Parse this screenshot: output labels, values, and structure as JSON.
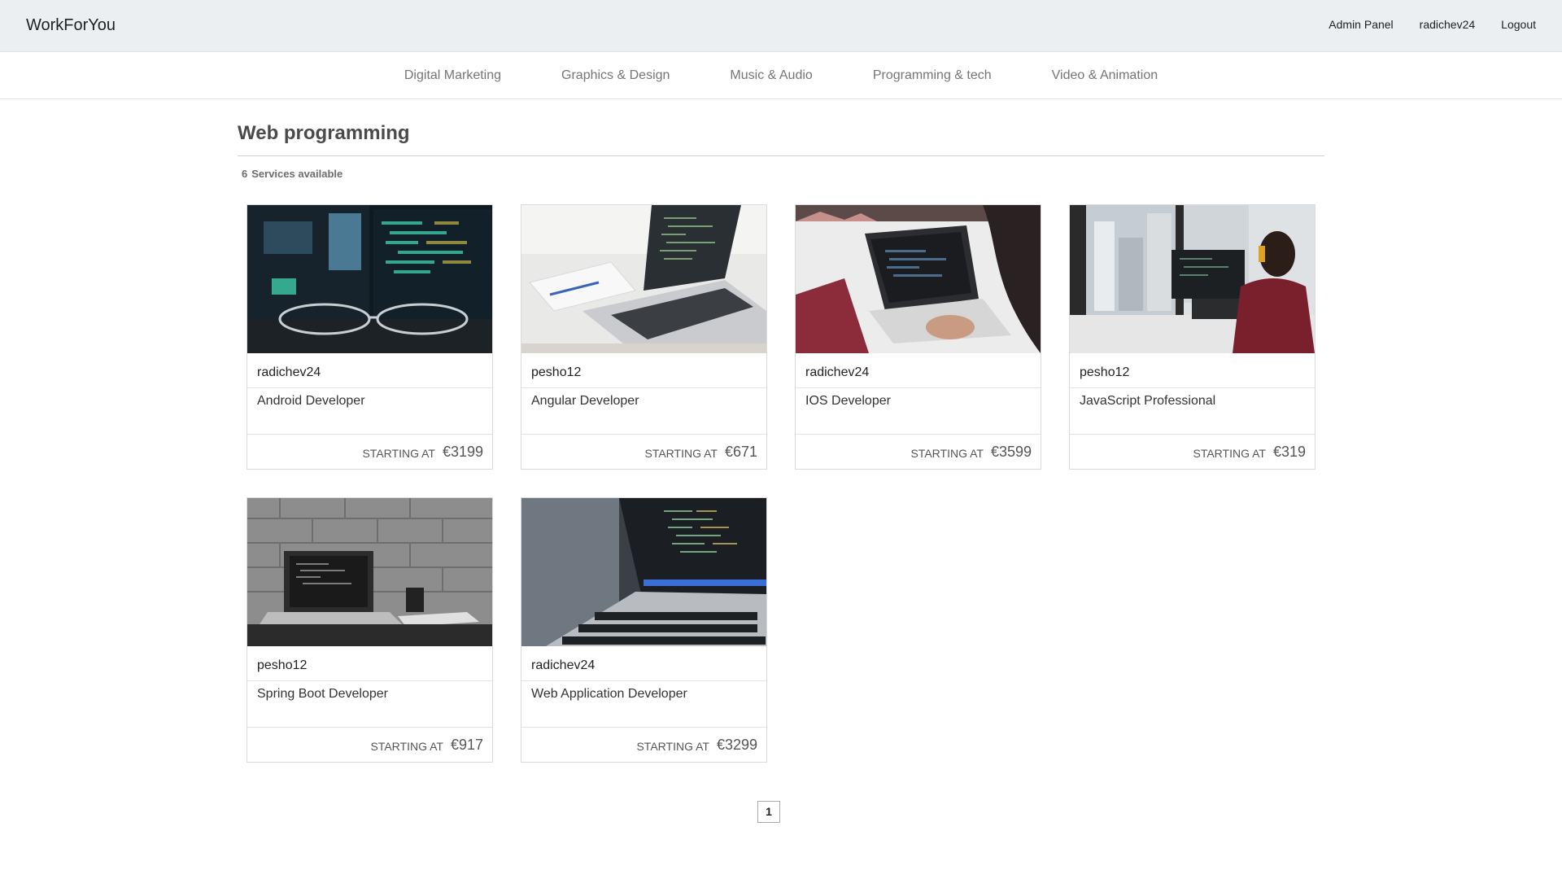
{
  "header": {
    "brand": "WorkForYou",
    "links": [
      "Admin Panel",
      "radichev24",
      "Logout"
    ]
  },
  "categories": [
    "Digital Marketing",
    "Graphics & Design",
    "Music & Audio",
    "Programming & tech",
    "Video & Animation"
  ],
  "page": {
    "title": "Web programming",
    "services_count": "6",
    "services_label": "Services available"
  },
  "services": [
    {
      "seller": "radichev24",
      "title": "Android Developer",
      "starting_label": "STARTING AT",
      "price": "€3199",
      "image": "monitors-and-glasses-photo"
    },
    {
      "seller": "pesho12",
      "title": "Angular Developer",
      "starting_label": "STARTING AT",
      "price": "€671",
      "image": "laptop-on-desk-photo"
    },
    {
      "seller": "radichev24",
      "title": "IOS Developer",
      "starting_label": "STARTING AT",
      "price": "€3599",
      "image": "person-typing-on-laptop-photo"
    },
    {
      "seller": "pesho12",
      "title": "JavaScript Professional",
      "starting_label": "STARTING AT",
      "price": "€319",
      "image": "woman-at-desktop-office-photo"
    },
    {
      "seller": "pesho12",
      "title": "Spring Boot Developer",
      "starting_label": "STARTING AT",
      "price": "€917",
      "image": "laptop-brick-wall-photo"
    },
    {
      "seller": "radichev24",
      "title": "Web Application Developer",
      "starting_label": "STARTING AT",
      "price": "€3299",
      "image": "code-on-laptop-closeup-photo"
    }
  ],
  "pagination": {
    "current": "1"
  },
  "colors": {
    "topbar": "#eceff1",
    "nav_text": "#757575",
    "heading": "#4a4a4a",
    "card_border": "#dadada"
  }
}
